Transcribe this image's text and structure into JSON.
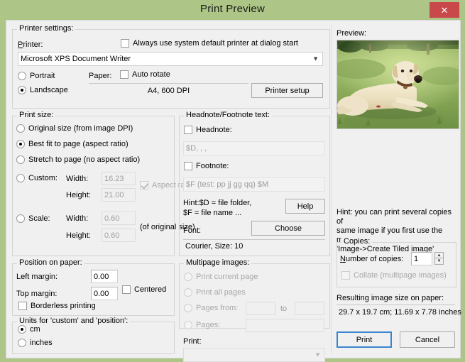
{
  "window": {
    "title": "Print Preview",
    "close_label": "✕",
    "titlebar_color": "#adc586",
    "close_color": "#c9494b"
  },
  "printer_settings": {
    "legend": "Printer settings:",
    "printer_label": "Printer:",
    "always_default_label": "Always use system default printer at dialog start",
    "always_default_checked": false,
    "printer_value": "Microsoft XPS Document Writer",
    "orientation": {
      "portrait": "Portrait",
      "landscape": "Landscape",
      "selected": "landscape"
    },
    "paper_label": "Paper:",
    "auto_rotate_label": "Auto rotate",
    "auto_rotate_checked": false,
    "paper_value": "A4,      600 DPI",
    "printer_setup_label": "Printer setup"
  },
  "print_size": {
    "legend": "Print size:",
    "options": [
      {
        "label": "Original size (from image DPI)",
        "selected": false
      },
      {
        "label": "Best fit to page (aspect ratio)",
        "selected": true
      },
      {
        "label": "Stretch to page (no aspect ratio)",
        "selected": false
      },
      {
        "label": "Custom:",
        "selected": false
      },
      {
        "label": "Scale:",
        "selected": false
      }
    ],
    "width_label": "Width:",
    "height_label": "Height:",
    "custom_width": "16.23",
    "custom_height": "21.00",
    "aspect_ratio_label": "Aspect ratio",
    "aspect_ratio_checked": true,
    "scale_width": "0.60",
    "scale_height": "0.60",
    "of_original_label": "(of original size)"
  },
  "headnote": {
    "legend": "Headnote/Footnote text:",
    "headnote_label": "Headnote:",
    "headnote_checked": false,
    "headnote_value": "$D, , ,",
    "footnote_label": "Footnote:",
    "footnote_checked": false,
    "footnote_value": "$F (test: pp jj gg qq) $M",
    "hint_line1": "Hint:$D = file folder,",
    "hint_line2": "$F = file name ...",
    "help_label": "Help",
    "font_label": "Font:",
    "choose_label": "Choose",
    "font_value": "Courier, Size: 10"
  },
  "position": {
    "legend": "Position on paper:",
    "left_margin_label": "Left margin:",
    "left_margin_value": "0.00",
    "top_margin_label": "Top margin:",
    "top_margin_value": "0.00",
    "centered_label": "Centered",
    "centered_checked": false,
    "borderless_label": "Borderless printing",
    "borderless_checked": false
  },
  "units": {
    "legend": "Units for 'custom' and 'position':",
    "options": [
      {
        "label": "cm",
        "selected": true
      },
      {
        "label": "inches",
        "selected": false
      }
    ]
  },
  "multipage": {
    "legend": "Multipage images:",
    "options": [
      {
        "label": "Print current page",
        "selected": false
      },
      {
        "label": "Print all pages",
        "selected": false
      },
      {
        "label": "Pages from:",
        "selected": false
      },
      {
        "label": "Pages:",
        "selected": false
      }
    ],
    "to_label": "to",
    "pages_from_value": "",
    "pages_to_value": "",
    "pages_value": "",
    "print_label": "Print:",
    "print_value": ""
  },
  "preview": {
    "legend": "Preview:",
    "image_alt": "labrador-dog-on-grass"
  },
  "right": {
    "hint_line1": "Hint: you can print several copies of",
    "hint_line2": "same image if you first use the menu:",
    "hint_line3": "'Image->Create Tiled image'",
    "copies_legend": "Copies:",
    "number_of_copies_label": "Number of copies:",
    "number_of_copies_value": "1",
    "collate_label": "Collate (multipage images)",
    "collate_checked": false,
    "result_label": "Resulting image size on paper:",
    "result_value": "29.7 x 19.7 cm; 11.69 x 7.78 inches",
    "print_button": "Print",
    "cancel_button": "Cancel"
  }
}
